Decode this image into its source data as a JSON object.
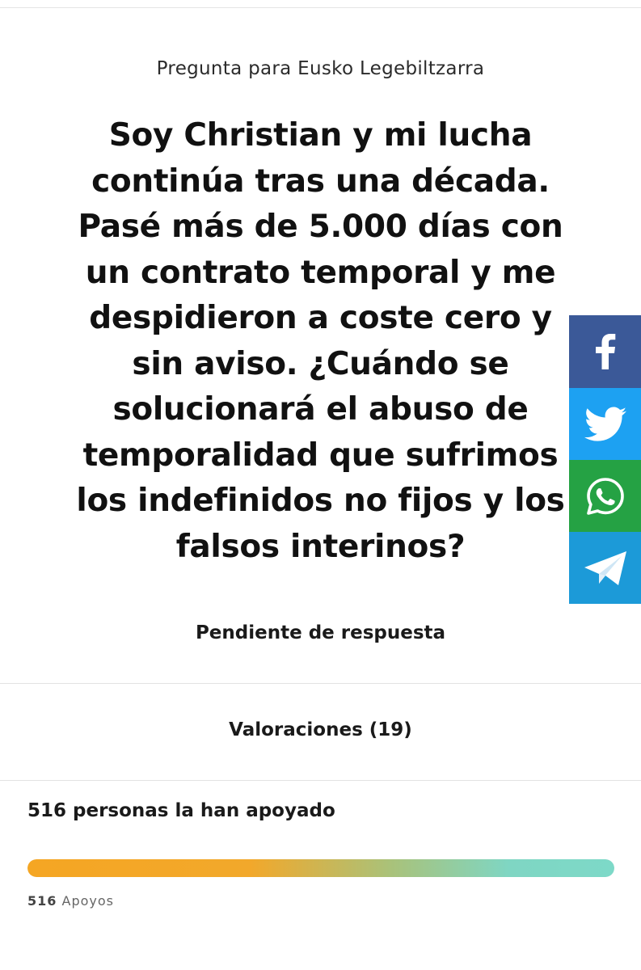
{
  "header": {
    "subtitle": "Pregunta para Eusko Legebiltzarra"
  },
  "question": {
    "lines": [
      "Soy Christian y mi lucha",
      "continúa tras una década.",
      "Pasé más de 5.000 días con",
      "un contrato temporal y me",
      "despidieron a coste cero y",
      "sin aviso. ¿Cuándo se",
      "solucionará el abuso de",
      "temporalidad que sufrimos",
      "los indefinidos no fijos y los",
      "falsos interinos?"
    ]
  },
  "status": "Pendiente de respuesta",
  "ratings": {
    "label": "Valoraciones (19)"
  },
  "support": {
    "heading": "516 personas la han apoyado",
    "count": "516",
    "count_label": "Apoyos",
    "progress_fraction": 1.0
  },
  "share": {
    "buttons": [
      {
        "network": "facebook",
        "icon": "facebook-icon",
        "color": "#3b5998"
      },
      {
        "network": "twitter",
        "icon": "twitter-icon",
        "color": "#1da1f2"
      },
      {
        "network": "whatsapp",
        "icon": "whatsapp-icon",
        "color": "#25a244"
      },
      {
        "network": "telegram",
        "icon": "telegram-icon",
        "color": "#1c9ad8"
      }
    ]
  }
}
